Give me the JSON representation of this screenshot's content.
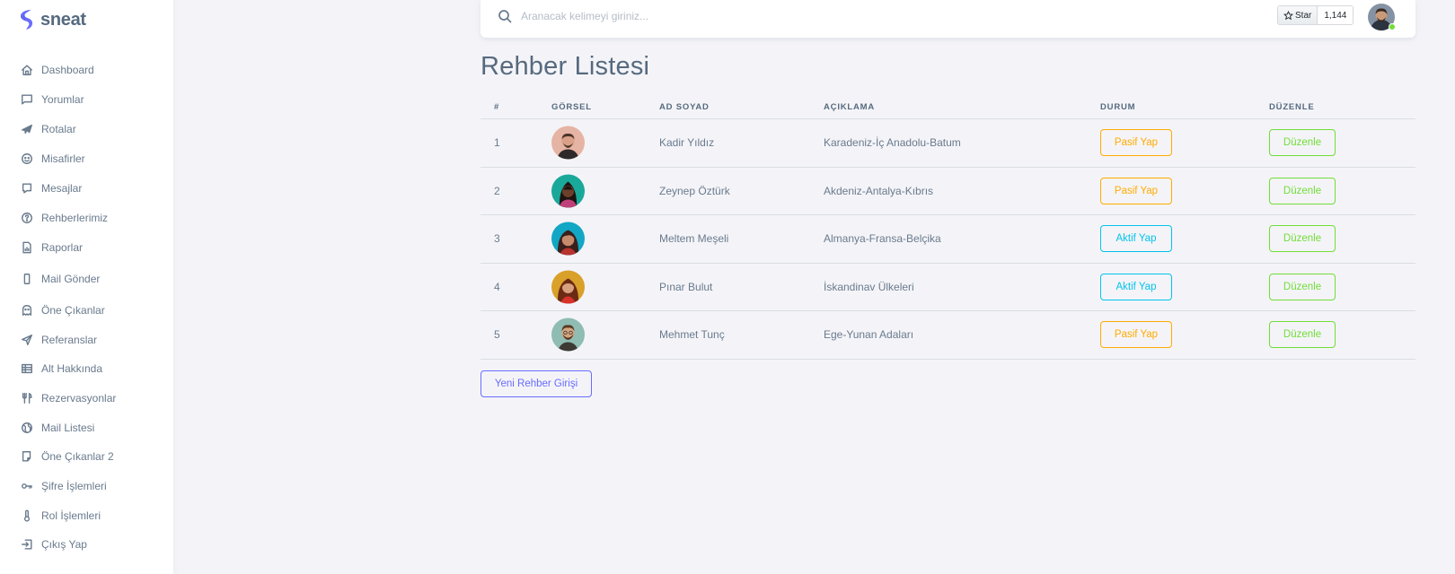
{
  "brand": {
    "name": "sneat",
    "color": "#696cff"
  },
  "sidebar": {
    "items": [
      {
        "label": "Dashboard",
        "icon": "home-icon"
      },
      {
        "label": "Yorumlar",
        "icon": "comment-icon"
      },
      {
        "label": "Rotalar",
        "icon": "plane-icon"
      },
      {
        "label": "Misafirler",
        "icon": "smile-icon"
      },
      {
        "label": "Mesajlar",
        "icon": "message-icon"
      },
      {
        "label": "Rehberlerimiz",
        "icon": "help-circle-icon"
      },
      {
        "label": "Raporlar",
        "icon": "report-file-icon"
      },
      {
        "label": "Mail Gönder",
        "icon": "mobile-icon"
      },
      {
        "label": "Öne Çıkanlar",
        "icon": "ghost-icon"
      },
      {
        "label": "Referanslar",
        "icon": "send-icon"
      },
      {
        "label": "Alt Hakkında",
        "icon": "layout-icon"
      },
      {
        "label": "Rezervasyonlar",
        "icon": "restaurant-icon"
      },
      {
        "label": "Mail Listesi",
        "icon": "world-icon"
      },
      {
        "label": "Öne Çıkanlar 2",
        "icon": "book-icon"
      },
      {
        "label": "Şifre İşlemleri",
        "icon": "key-icon"
      },
      {
        "label": "Rol İşlemleri",
        "icon": "thermometer-icon"
      },
      {
        "label": "Çıkış Yap",
        "icon": "logout-icon"
      }
    ]
  },
  "navbar": {
    "search_placeholder": "Aranacak kelimeyi giriniz...",
    "github": {
      "star_label": "Star",
      "count": "1,144"
    }
  },
  "page": {
    "title": "Rehber Listesi"
  },
  "table": {
    "headers": {
      "num": "#",
      "image": "GÖRSEL",
      "name": "AD SOYAD",
      "desc": "AÇIKLAMA",
      "status": "DURUM",
      "edit": "DÜZENLE"
    },
    "rows": [
      {
        "num": "1",
        "name": "Kadir Yıldız",
        "desc": "Karadeniz-İç Anadolu-Batum",
        "status_action": "Pasif Yap",
        "status_style": "warning",
        "edit_label": "Düzenle"
      },
      {
        "num": "2",
        "name": "Zeynep Öztürk",
        "desc": "Akdeniz-Antalya-Kıbrıs",
        "status_action": "Pasif Yap",
        "status_style": "warning",
        "edit_label": "Düzenle"
      },
      {
        "num": "3",
        "name": "Meltem Meşeli",
        "desc": "Almanya-Fransa-Belçika",
        "status_action": "Aktif Yap",
        "status_style": "info",
        "edit_label": "Düzenle"
      },
      {
        "num": "4",
        "name": "Pınar Bulut",
        "desc": "İskandinav Ülkeleri",
        "status_action": "Aktif Yap",
        "status_style": "info",
        "edit_label": "Düzenle"
      },
      {
        "num": "5",
        "name": "Mehmet Tunç",
        "desc": "Ege-Yunan Adaları",
        "status_action": "Pasif Yap",
        "status_style": "warning",
        "edit_label": "Düzenle"
      }
    ]
  },
  "actions": {
    "new_guide_label": "Yeni Rehber Girişi"
  },
  "colors": {
    "warning": "#ffab00",
    "info": "#03c3ec",
    "success": "#71dd37",
    "primary": "#696cff"
  }
}
